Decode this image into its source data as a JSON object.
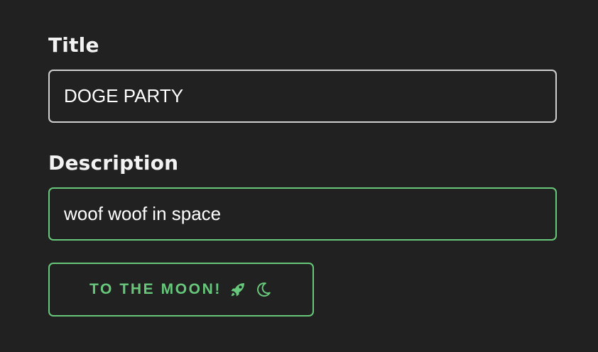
{
  "form": {
    "title_label": "Title",
    "title_value": "DOGE PARTY",
    "description_label": "Description",
    "description_value": "woof woof in space",
    "submit_label": "TO THE MOON!",
    "submit_icons": [
      "rocket-icon",
      "crescent-moon-icon"
    ]
  },
  "colors": {
    "background": "#212121",
    "accent": "#67c77a",
    "input_border": "#cfcfcf",
    "text": "#ffffff"
  }
}
